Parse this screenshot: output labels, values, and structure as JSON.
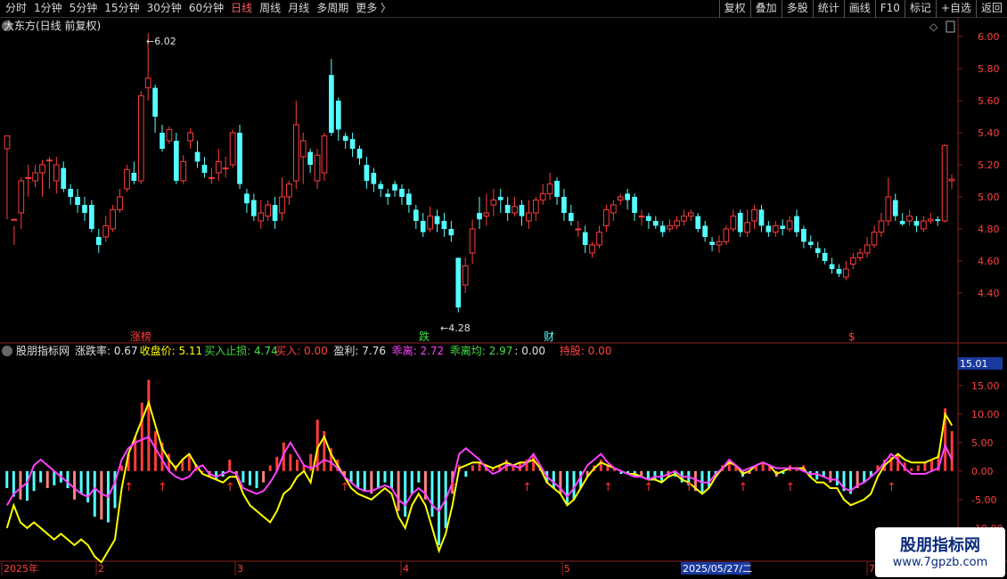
{
  "toolbar": {
    "periods": [
      "分时",
      "1分钟",
      "5分钟",
      "15分钟",
      "30分钟",
      "60分钟",
      "日线",
      "周线",
      "月线",
      "多周期",
      "更多 〉"
    ],
    "active_period": "日线",
    "tools": [
      "复权",
      "叠加",
      "多股",
      "统计",
      "画线",
      "F10",
      "标记",
      "+自选",
      "返回"
    ]
  },
  "main_chart": {
    "title": "大东方(日线 前复权)",
    "high_label": "6.02",
    "low_label": "4.28",
    "price_ticks": [
      "6.00",
      "5.80",
      "5.60",
      "5.40",
      "5.20",
      "5.00",
      "4.80",
      "4.60",
      "4.40"
    ],
    "event_labels": [
      "涨榜",
      "跌",
      "财",
      "$"
    ]
  },
  "indicator": {
    "name": "股朋指标网",
    "fields": [
      {
        "label": "涨跌率: 0.67",
        "color": "#e0e0e0"
      },
      {
        "label": "收盘价: 5.11",
        "color": "#ffff00"
      },
      {
        "label": "买入止损: 4.74",
        "color": "#40e040"
      },
      {
        "label": "买入: 0.00",
        "color": "#ff4040"
      },
      {
        "label": "盈利: 7.76",
        "color": "#e0e0e0"
      },
      {
        "label": "乖离: 2.72",
        "color": "#ff40ff"
      },
      {
        "label": "乖离均: 2.97",
        "color": "#40e040"
      },
      {
        "label": ": 0.00",
        "color": "#e0e0e0"
      },
      {
        "label": "持股: 0.00",
        "color": "#ff4040"
      }
    ],
    "current_value": "15.01",
    "y_ticks": [
      "15.00",
      "10.00",
      "5.00",
      "0.00",
      "-5.00",
      "-10.00"
    ]
  },
  "date_axis": {
    "labels": [
      "2025年",
      "2",
      "3",
      "4",
      "5",
      "7"
    ],
    "cursor_date": "2025/05/27/二"
  },
  "watermark": {
    "title": "股朋指标网",
    "url": "www.7gpzb.com"
  },
  "colors": {
    "up": "#ff3c3c",
    "down": "#54ffff",
    "yellow": "#ffff00",
    "magenta": "#ff40ff",
    "green": "#40e040"
  },
  "chart_data": {
    "type": "candlestick",
    "price_range": [
      4.2,
      6.05
    ],
    "candles": [
      [
        5.3,
        5.38,
        4.86,
        5.38
      ],
      [
        4.86,
        4.86,
        4.7,
        4.82
      ],
      [
        4.9,
        5.1,
        4.8,
        5.12
      ],
      [
        5.12,
        5.12,
        5.0,
        5.2
      ],
      [
        5.1,
        5.15,
        5.06,
        5.2
      ],
      [
        5.15,
        5.2,
        5.0,
        5.23
      ],
      [
        5.23,
        5.23,
        5.05,
        5.25
      ],
      [
        5.1,
        5.2,
        5.02,
        5.25
      ],
      [
        5.18,
        5.05,
        5.03,
        5.22
      ],
      [
        5.05,
        5.0,
        4.95,
        5.08
      ],
      [
        5.0,
        4.95,
        4.9,
        5.05
      ],
      [
        4.95,
        4.9,
        4.85,
        5.0
      ],
      [
        4.95,
        4.8,
        4.78,
        4.98
      ],
      [
        4.75,
        4.7,
        4.65,
        4.8
      ],
      [
        4.75,
        4.82,
        4.72,
        4.88
      ],
      [
        4.8,
        4.92,
        4.78,
        4.95
      ],
      [
        4.92,
        5.0,
        4.9,
        5.05
      ],
      [
        5.05,
        5.17,
        5.03,
        5.2
      ],
      [
        5.15,
        5.1,
        5.08,
        5.22
      ],
      [
        5.1,
        5.63,
        5.08,
        5.66
      ],
      [
        5.68,
        5.74,
        5.6,
        6.02
      ],
      [
        5.68,
        5.5,
        5.4,
        5.7
      ],
      [
        5.4,
        5.3,
        5.28,
        5.45
      ],
      [
        5.35,
        5.42,
        5.33,
        5.44
      ],
      [
        5.35,
        5.1,
        5.08,
        5.4
      ],
      [
        5.1,
        5.22,
        5.08,
        5.26
      ],
      [
        5.35,
        5.4,
        5.3,
        5.43
      ],
      [
        5.28,
        5.22,
        5.18,
        5.35
      ],
      [
        5.2,
        5.15,
        5.12,
        5.25
      ],
      [
        5.12,
        5.12,
        5.08,
        5.18
      ],
      [
        5.15,
        5.22,
        5.1,
        5.3
      ],
      [
        5.18,
        5.18,
        5.12,
        5.25
      ],
      [
        5.2,
        5.4,
        5.18,
        5.42
      ],
      [
        5.4,
        5.08,
        5.05,
        5.45
      ],
      [
        5.02,
        4.96,
        4.9,
        5.05
      ],
      [
        4.98,
        4.88,
        4.85,
        5.02
      ],
      [
        4.85,
        4.9,
        4.8,
        4.98
      ],
      [
        4.88,
        4.95,
        4.85,
        4.98
      ],
      [
        4.95,
        4.85,
        4.8,
        5.0
      ],
      [
        4.9,
        5.0,
        4.85,
        5.12
      ],
      [
        5.0,
        5.08,
        4.95,
        5.1
      ],
      [
        5.1,
        5.45,
        5.05,
        5.6
      ],
      [
        5.25,
        5.35,
        5.08,
        5.4
      ],
      [
        5.28,
        5.2,
        5.15,
        5.3
      ],
      [
        5.1,
        5.26,
        5.05,
        5.3
      ],
      [
        5.15,
        5.38,
        5.1,
        5.4
      ],
      [
        5.76,
        5.4,
        5.38,
        5.86
      ],
      [
        5.6,
        5.42,
        5.35,
        5.62
      ],
      [
        5.38,
        5.35,
        5.3,
        5.4
      ],
      [
        5.36,
        5.3,
        5.25,
        5.4
      ],
      [
        5.3,
        5.24,
        5.2,
        5.32
      ],
      [
        5.2,
        5.1,
        5.05,
        5.25
      ],
      [
        5.15,
        5.08,
        5.03,
        5.18
      ],
      [
        5.08,
        5.05,
        5.0,
        5.1
      ],
      [
        5.02,
        5.0,
        4.95,
        5.05
      ],
      [
        5.08,
        5.04,
        5.0,
        5.1
      ],
      [
        5.05,
        5.0,
        4.95,
        5.08
      ],
      [
        5.02,
        4.95,
        4.9,
        5.05
      ],
      [
        4.92,
        4.85,
        4.8,
        4.95
      ],
      [
        4.85,
        4.78,
        4.75,
        4.9
      ],
      [
        4.8,
        4.88,
        4.78,
        4.94
      ],
      [
        4.88,
        4.83,
        4.78,
        4.92
      ],
      [
        4.85,
        4.8,
        4.75,
        4.9
      ],
      [
        4.8,
        4.76,
        4.72,
        4.85
      ],
      [
        4.62,
        4.31,
        4.28,
        4.62
      ],
      [
        4.45,
        4.57,
        4.4,
        4.62
      ],
      [
        4.65,
        4.8,
        4.58,
        4.86
      ],
      [
        4.9,
        4.86,
        4.8,
        5.0
      ],
      [
        4.88,
        4.9,
        4.82,
        5.02
      ],
      [
        4.95,
        4.98,
        4.88,
        5.05
      ],
      [
        5.0,
        4.98,
        4.9,
        5.05
      ],
      [
        4.95,
        4.9,
        4.85,
        5.0
      ],
      [
        4.9,
        4.94,
        4.88,
        5.0
      ],
      [
        4.95,
        4.88,
        4.82,
        4.98
      ],
      [
        4.85,
        4.9,
        4.8,
        4.98
      ],
      [
        4.9,
        4.98,
        4.85,
        5.0
      ],
      [
        4.98,
        5.02,
        4.95,
        5.08
      ],
      [
        5.02,
        5.08,
        4.98,
        5.15
      ],
      [
        5.1,
        5.0,
        4.95,
        5.12
      ],
      [
        5.0,
        4.9,
        4.85,
        5.05
      ],
      [
        4.9,
        4.85,
        4.82,
        4.95
      ],
      [
        4.8,
        4.8,
        4.75,
        4.85
      ],
      [
        4.78,
        4.7,
        4.65,
        4.82
      ],
      [
        4.65,
        4.7,
        4.62,
        4.72
      ],
      [
        4.7,
        4.78,
        4.68,
        4.82
      ],
      [
        4.82,
        4.92,
        4.78,
        4.95
      ],
      [
        4.9,
        4.95,
        4.85,
        4.98
      ],
      [
        4.98,
        5.0,
        4.95,
        5.02
      ],
      [
        5.02,
        4.98,
        4.92,
        5.05
      ],
      [
        5.0,
        4.9,
        4.85,
        5.02
      ],
      [
        4.88,
        4.88,
        4.82,
        4.92
      ],
      [
        4.88,
        4.85,
        4.8,
        4.9
      ],
      [
        4.85,
        4.82,
        4.8,
        4.88
      ],
      [
        4.82,
        4.78,
        4.75,
        4.85
      ],
      [
        4.8,
        4.82,
        4.78,
        4.86
      ],
      [
        4.82,
        4.85,
        4.8,
        4.88
      ],
      [
        4.85,
        4.88,
        4.82,
        4.92
      ],
      [
        4.88,
        4.9,
        4.85,
        4.92
      ],
      [
        4.88,
        4.8,
        4.78,
        4.9
      ],
      [
        4.82,
        4.75,
        4.72,
        4.85
      ],
      [
        4.72,
        4.7,
        4.66,
        4.75
      ],
      [
        4.7,
        4.72,
        4.65,
        4.76
      ],
      [
        4.72,
        4.8,
        4.7,
        4.82
      ],
      [
        4.8,
        4.88,
        4.78,
        4.92
      ],
      [
        4.9,
        4.78,
        4.75,
        4.92
      ],
      [
        4.78,
        4.84,
        4.75,
        4.92
      ],
      [
        4.85,
        4.92,
        4.8,
        4.95
      ],
      [
        4.92,
        4.82,
        4.78,
        4.95
      ],
      [
        4.82,
        4.78,
        4.75,
        4.85
      ],
      [
        4.78,
        4.82,
        4.75,
        4.85
      ],
      [
        4.82,
        4.8,
        4.76,
        4.86
      ],
      [
        4.8,
        4.85,
        4.78,
        4.88
      ],
      [
        4.88,
        4.78,
        4.75,
        4.92
      ],
      [
        4.8,
        4.72,
        4.68,
        4.82
      ],
      [
        4.72,
        4.7,
        4.68,
        4.76
      ],
      [
        4.68,
        4.65,
        4.62,
        4.72
      ],
      [
        4.65,
        4.6,
        4.58,
        4.68
      ],
      [
        4.58,
        4.55,
        4.52,
        4.62
      ],
      [
        4.55,
        4.52,
        4.5,
        4.58
      ],
      [
        4.5,
        4.55,
        4.48,
        4.6
      ],
      [
        4.58,
        4.62,
        4.55,
        4.65
      ],
      [
        4.62,
        4.65,
        4.6,
        4.68
      ],
      [
        4.65,
        4.7,
        4.62,
        4.75
      ],
      [
        4.7,
        4.78,
        4.68,
        4.82
      ],
      [
        4.78,
        4.85,
        4.75,
        4.9
      ],
      [
        4.85,
        5.0,
        4.82,
        5.12
      ],
      [
        4.98,
        4.88,
        4.85,
        5.02
      ],
      [
        4.85,
        4.83,
        4.82,
        4.9
      ],
      [
        4.85,
        4.88,
        4.82,
        4.92
      ],
      [
        4.85,
        4.82,
        4.78,
        4.88
      ],
      [
        4.8,
        4.85,
        4.78,
        4.88
      ],
      [
        4.85,
        4.86,
        4.83,
        4.9
      ],
      [
        4.86,
        4.85,
        4.82,
        4.88
      ],
      [
        4.85,
        5.32,
        4.84,
        5.33
      ],
      [
        5.1,
        5.11,
        5.05,
        5.14
      ]
    ],
    "oscillator": {
      "zero": 0,
      "yrange": [
        -13,
        17
      ],
      "hist": [
        -3,
        -4.5,
        -5,
        -5.2,
        -3.5,
        -2,
        -3,
        -2.5,
        -2,
        -3,
        -5,
        -4,
        -5.5,
        -8,
        -8.5,
        -9,
        -6.5,
        1,
        3,
        6,
        12,
        16,
        7,
        5,
        3,
        1,
        2,
        3,
        1.2,
        0,
        -1,
        -1.5,
        -1,
        2,
        -1,
        -2,
        -2.5,
        -3,
        -2,
        1,
        2.5,
        5,
        3,
        2,
        1,
        3,
        9,
        7,
        4,
        2,
        -1,
        -2,
        -3,
        -3.5,
        -4,
        -3,
        -2,
        -3,
        -7,
        -8,
        -4,
        -2,
        -5,
        -8,
        -13,
        -10,
        -4,
        1,
        -1,
        1,
        1.5,
        1,
        0.5,
        1,
        2,
        1,
        1.5,
        2,
        3,
        1,
        -2,
        -3,
        -4,
        -6,
        -5,
        -3,
        -1,
        1,
        2,
        1,
        0.5,
        -0.5,
        -0.5,
        -1,
        -1,
        -1.5,
        -1.5,
        -2,
        -1,
        -1,
        -2,
        -2.5,
        -3.5,
        -4,
        -3,
        -1,
        1,
        2,
        1,
        -1,
        -0.5,
        1,
        1.5,
        1,
        -1,
        -0.5,
        1,
        0.5,
        1,
        -1,
        -1.5,
        -1,
        -2,
        -2.5,
        -3.5,
        -4,
        -3,
        -2,
        -1,
        1,
        2,
        2.5,
        3,
        1.5,
        0.5,
        1,
        1.5,
        2,
        3,
        11,
        7
      ],
      "yellow": [
        -10,
        -6,
        -9,
        -10,
        -9,
        -10,
        -11,
        -12,
        -11,
        -12,
        -13,
        -12,
        -13,
        -15,
        -16,
        -14,
        -12,
        -3,
        3,
        6,
        9,
        12,
        8,
        4,
        2,
        0.5,
        2,
        3,
        1,
        -0.5,
        -1,
        -1.5,
        -2,
        -1,
        -1,
        -4,
        -6,
        -7,
        -8,
        -9,
        -7,
        -4,
        -3,
        -1,
        0,
        -2,
        4,
        6,
        3,
        1,
        -1,
        -3,
        -4,
        -4.5,
        -5,
        -4,
        -3,
        -4,
        -8,
        -10,
        -6,
        -4,
        -6,
        -10,
        -14,
        -11,
        -6,
        0.5,
        1,
        1.5,
        1.5,
        1,
        0.5,
        1,
        1.5,
        1,
        1.5,
        1.5,
        2,
        0.5,
        -2,
        -3,
        -4,
        -6,
        -5,
        -3,
        -1,
        0.5,
        1.5,
        1,
        0.5,
        0,
        -0.5,
        -0.5,
        -1,
        -1.5,
        -1.5,
        -2,
        -1,
        -0.5,
        -1.5,
        -2,
        -3,
        -4,
        -3,
        -1,
        0.5,
        1.5,
        1,
        -0.5,
        0,
        1,
        1.5,
        1,
        -0.5,
        0,
        0.5,
        0.5,
        0.5,
        -1,
        -2,
        -2,
        -3,
        -3,
        -5,
        -6,
        -5.5,
        -5,
        -4,
        -1,
        1,
        2,
        3,
        2,
        1.5,
        1.5,
        1.5,
        2,
        2.5,
        10,
        8
      ],
      "magenta": [
        -6,
        -4,
        -3,
        -2,
        1,
        2,
        1,
        0,
        -1,
        -2,
        -3,
        -4,
        -4.5,
        -3,
        -4,
        -4.5,
        -2,
        2,
        4,
        5,
        5.5,
        6,
        4,
        2,
        0,
        -1,
        -1.5,
        -1,
        0.5,
        1,
        -0.5,
        -1,
        -0.5,
        0,
        -0.5,
        -3,
        -3.5,
        -4,
        -3.5,
        -2,
        0,
        3,
        5,
        3,
        1,
        0.5,
        1,
        2,
        1.5,
        0.5,
        -1,
        -2,
        -3,
        -3.5,
        -3.5,
        -3,
        -2.5,
        -3,
        -5,
        -6,
        -4,
        -3,
        -4,
        -6,
        -7,
        -5,
        -2,
        3,
        4,
        3,
        2,
        0.5,
        -0.5,
        0,
        1,
        1,
        0.5,
        1.5,
        3,
        1,
        -1,
        -2,
        -3,
        -4.5,
        -3,
        -1,
        1,
        2,
        3,
        1.5,
        0.5,
        0,
        -0.5,
        -1,
        -1,
        -1.5,
        -1,
        -1,
        -0.5,
        0,
        -1,
        -1,
        -1.5,
        -2,
        -2,
        -0.5,
        0.5,
        2,
        1,
        0,
        0.5,
        1,
        1.5,
        1,
        0.5,
        0.5,
        0.5,
        0.5,
        0,
        -0.5,
        -0.5,
        -1,
        -1.5,
        -1.5,
        -3,
        -3.5,
        -2.5,
        -2,
        -1,
        0,
        1.5,
        3,
        2,
        0.5,
        -0.5,
        -0.5,
        -0.5,
        0,
        0.5,
        4.5,
        2
      ]
    }
  }
}
